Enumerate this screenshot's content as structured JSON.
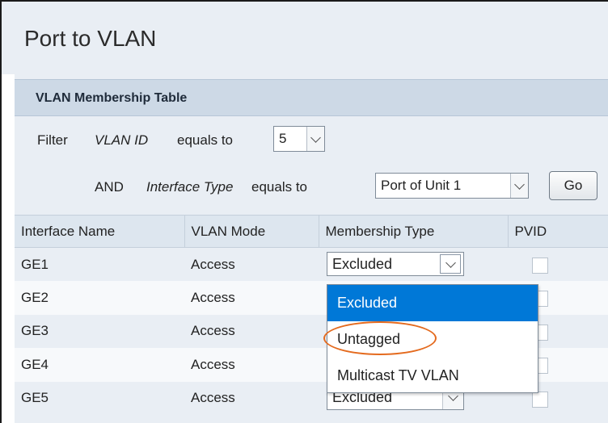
{
  "page": {
    "title": "Port to VLAN"
  },
  "panel": {
    "title": "VLAN Membership Table"
  },
  "filter": {
    "filter_label": "Filter",
    "vlan_id_label": "VLAN ID",
    "equals_to": "equals to",
    "vlan_id_value": "5",
    "and_label": "AND",
    "interface_type_label": "Interface Type",
    "interface_type_value": "Port of Unit 1",
    "go_label": "Go"
  },
  "table": {
    "columns": [
      "Interface Name",
      "VLAN Mode",
      "Membership Type",
      "PVID"
    ],
    "rows": [
      {
        "interface": "GE1",
        "mode": "Access",
        "membership": "Excluded",
        "pvid": false
      },
      {
        "interface": "GE2",
        "mode": "Access",
        "membership": "",
        "pvid": false
      },
      {
        "interface": "GE3",
        "mode": "Access",
        "membership": "",
        "pvid": false
      },
      {
        "interface": "GE4",
        "mode": "Access",
        "membership": "",
        "pvid": false
      },
      {
        "interface": "GE5",
        "mode": "Access",
        "membership": "Excluded",
        "pvid": false
      }
    ]
  },
  "dropdown": {
    "options": [
      "Excluded",
      "Untagged",
      "Multicast TV VLAN"
    ],
    "selected": "Excluded",
    "highlighted_option": "Untagged"
  },
  "colors": {
    "accent_selected": "#0078d7",
    "annotation_oval": "#e46a1e"
  }
}
